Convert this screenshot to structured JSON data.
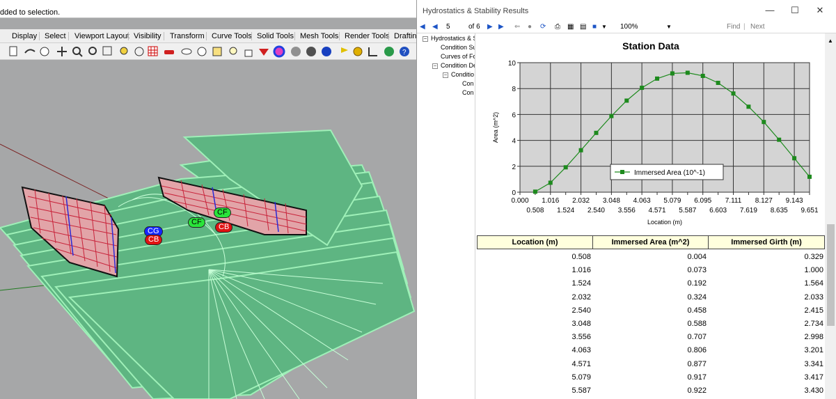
{
  "rhino": {
    "command_text": "dded to selection.",
    "tabs": [
      "Display",
      "Select",
      "Viewport Layout",
      "Visibility",
      "Transform",
      "Curve Tools",
      "Solid Tools",
      "Mesh Tools",
      "Render Tools",
      "Drafting"
    ],
    "labels": {
      "cg": "CG",
      "cb_left": "CB",
      "cf_mid": "CF",
      "cf_right": "CF",
      "cb_right": "CB"
    },
    "colors": {
      "viewport_bg": "#a6a7a8",
      "plane_fill": "#5eb582",
      "plane_edge": "#9ff0b8",
      "hull_grid_red": "#c8233a",
      "hull_grid_blue": "#2a2ad6",
      "label_green": "#29e43a",
      "label_blue": "#1426ff",
      "label_red": "#e01212"
    }
  },
  "window": {
    "title": "Hydrostatics & Stability Results",
    "controls": {
      "minimize": "—",
      "maximize": "☐",
      "close": "✕"
    }
  },
  "report_toolbar": {
    "page_current": "5",
    "page_of": "of 6",
    "zoom": "100%",
    "find": "Find",
    "separator": "|",
    "next": "Next"
  },
  "tree": {
    "items": [
      "Hydrostatics & S",
      "Condition Su",
      "Curves of Fo",
      "Condition De",
      "Conditio",
      "Con",
      "Con"
    ]
  },
  "chart_data": {
    "type": "line",
    "title": "Station Data",
    "xlabel": "Location (m)",
    "ylabel": "Area (m^2)",
    "ylim": [
      0,
      10
    ],
    "yticks": [
      0,
      2,
      4,
      6,
      8,
      10
    ],
    "xticks_top": [
      "0.000",
      "1.016",
      "2.032",
      "3.048",
      "4.063",
      "5.079",
      "6.095",
      "7.111",
      "8.127",
      "9.143"
    ],
    "xticks_bottom": [
      "0.508",
      "1.524",
      "2.540",
      "3.556",
      "4.571",
      "5.587",
      "6.603",
      "7.619",
      "8.635",
      "9.651"
    ],
    "grid": true,
    "legend_position": "bottom-center",
    "series": [
      {
        "name": "Immersed Area (10^-1)",
        "color": "#1d8a1d",
        "x": [
          0.508,
          1.016,
          1.524,
          2.032,
          2.54,
          3.048,
          3.556,
          4.063,
          4.571,
          5.079,
          5.587,
          6.095,
          6.603,
          7.111,
          7.619,
          8.127,
          8.635,
          9.143,
          9.651
        ],
        "y": [
          0.04,
          0.73,
          1.92,
          3.24,
          4.58,
          5.88,
          7.07,
          8.06,
          8.77,
          9.17,
          9.22,
          8.98,
          8.44,
          7.62,
          6.6,
          5.42,
          4.05,
          2.62,
          1.19
        ]
      }
    ]
  },
  "table": {
    "headers": [
      "Location (m)",
      "Immersed Area (m^2)",
      "Immersed Girth (m)"
    ],
    "rows": [
      [
        "0.508",
        "0.004",
        "0.329"
      ],
      [
        "1.016",
        "0.073",
        "1.000"
      ],
      [
        "1.524",
        "0.192",
        "1.564"
      ],
      [
        "2.032",
        "0.324",
        "2.033"
      ],
      [
        "2.540",
        "0.458",
        "2.415"
      ],
      [
        "3.048",
        "0.588",
        "2.734"
      ],
      [
        "3.556",
        "0.707",
        "2.998"
      ],
      [
        "4.063",
        "0.806",
        "3.201"
      ],
      [
        "4.571",
        "0.877",
        "3.341"
      ],
      [
        "5.079",
        "0.917",
        "3.417"
      ],
      [
        "5.587",
        "0.922",
        "3.430"
      ]
    ]
  }
}
